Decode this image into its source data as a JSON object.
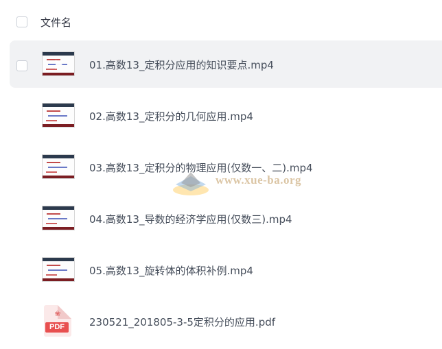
{
  "header": {
    "column_label": "文件名"
  },
  "files": [
    {
      "name": "01.高数13_定积分应用的知识要点.mp4",
      "type": "video",
      "icon": "video-thumbnail-icon",
      "hovered": true
    },
    {
      "name": "02.高数13_定积分的几何应用.mp4",
      "type": "video",
      "icon": "video-thumbnail-icon"
    },
    {
      "name": "03.高数13_定积分的物理应用(仅数一、二).mp4",
      "type": "video",
      "icon": "video-thumbnail-icon"
    },
    {
      "name": "04.高数13_导数的经济学应用(仅数三).mp4",
      "type": "video",
      "icon": "video-thumbnail-icon"
    },
    {
      "name": "05.高数13_旋转体的体积补例.mp4",
      "type": "video",
      "icon": "video-thumbnail-icon"
    },
    {
      "name": "230521_201805-3-5定积分的应用.pdf",
      "type": "pdf",
      "icon": "pdf-file-icon",
      "badge": "PDF"
    }
  ],
  "watermark": {
    "text": "www.xue-ba.org"
  },
  "colors": {
    "hover_row_bg": "#f1f2f4",
    "text": "#454d5a",
    "pdf_red": "#e84f4f"
  }
}
